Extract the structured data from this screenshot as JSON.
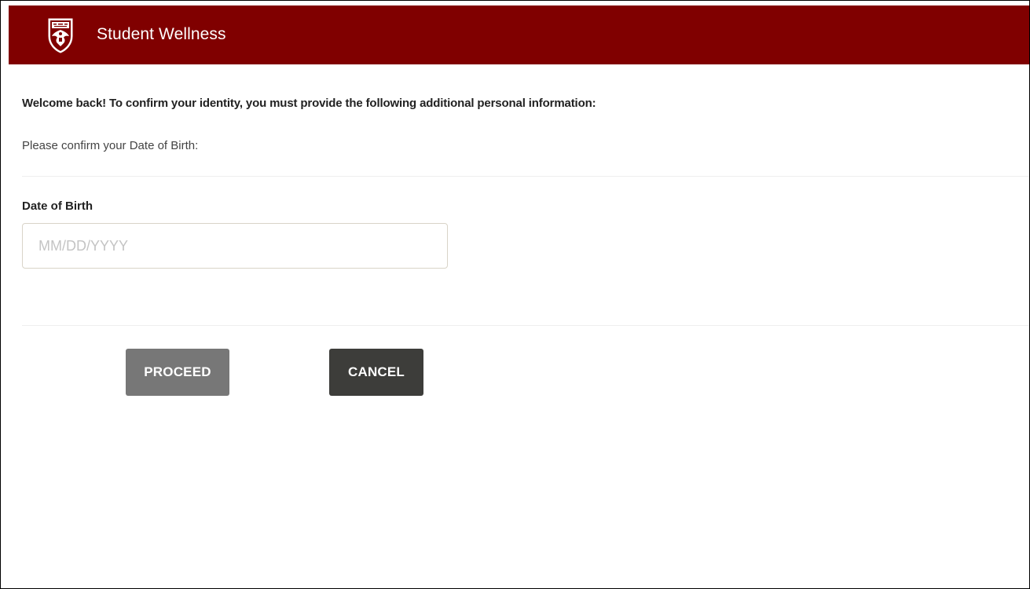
{
  "header": {
    "title": "Student Wellness",
    "logo_icon": "university-shield-icon",
    "background_color": "#800000"
  },
  "main": {
    "welcome_message": "Welcome back! To confirm your identity, you must provide the following additional personal information:",
    "instruction": "Please confirm your Date of Birth:",
    "dob": {
      "label": "Date of Birth",
      "value": "",
      "placeholder": "MM/DD/YYYY"
    }
  },
  "actions": {
    "proceed_label": "PROCEED",
    "cancel_label": "CANCEL",
    "proceed_color": "#777777",
    "cancel_color": "#3d3d3a"
  }
}
